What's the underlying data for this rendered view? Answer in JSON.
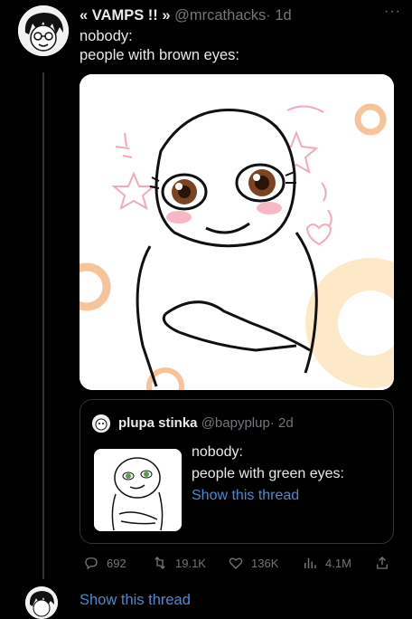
{
  "tweet": {
    "display_name": "« VAMPS !! »",
    "handle": "@mrcathacks",
    "time": "· 1d",
    "more_label": "···",
    "lines": [
      "nobody:",
      "people with brown eyes:"
    ]
  },
  "quote": {
    "display_name": "plupa stinka",
    "handle": "@bapyplup",
    "time": "· 2d",
    "lines": [
      "nobody:",
      "people with green eyes:"
    ],
    "show_thread": "Show this thread"
  },
  "actions": {
    "replies": "692",
    "retweets": "19.1K",
    "likes": "136K",
    "views": "4.1M"
  },
  "footer": {
    "show_thread": "Show this thread"
  },
  "colors": {
    "background": "#000000",
    "text": "#e7e9ea",
    "muted": "#71767b",
    "link": "#4a8bd0",
    "border": "#2f3336"
  },
  "icons": [
    "more-icon",
    "reply-icon",
    "retweet-icon",
    "like-icon",
    "views-icon",
    "share-icon"
  ]
}
